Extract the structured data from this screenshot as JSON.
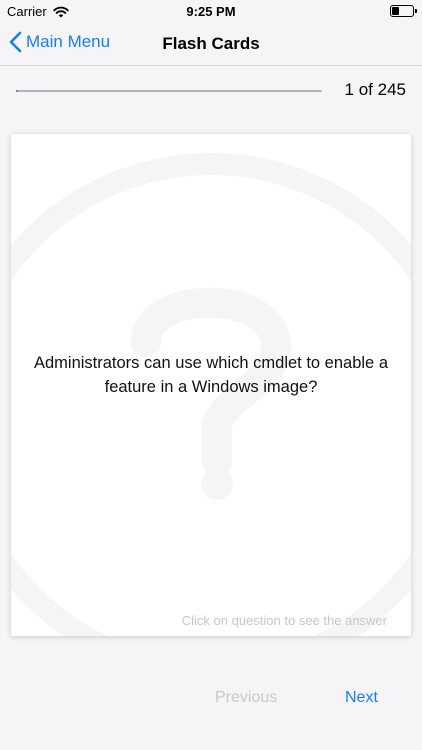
{
  "status_bar": {
    "carrier": "Carrier",
    "time": "9:25 PM",
    "battery_level": 0.3
  },
  "nav": {
    "back_label": "Main Menu",
    "back_icon": "chevron-left-icon",
    "title": "Flash Cards"
  },
  "progress": {
    "label": "1 of 245",
    "current": 1,
    "total": 245,
    "fraction": 0.004
  },
  "card": {
    "question": "Administrators can use which cmdlet to enable a feature in a Windows image?",
    "hint": "Click on question to see the answer",
    "watermark_icon": "question-mark-icon"
  },
  "buttons": {
    "previous_label": "Previous",
    "next_label": "Next"
  },
  "colors": {
    "accent": "#1a7df2",
    "disabled": "#c8c8cc",
    "hint": "#c7c7cc",
    "background": "#f5f5f7"
  }
}
